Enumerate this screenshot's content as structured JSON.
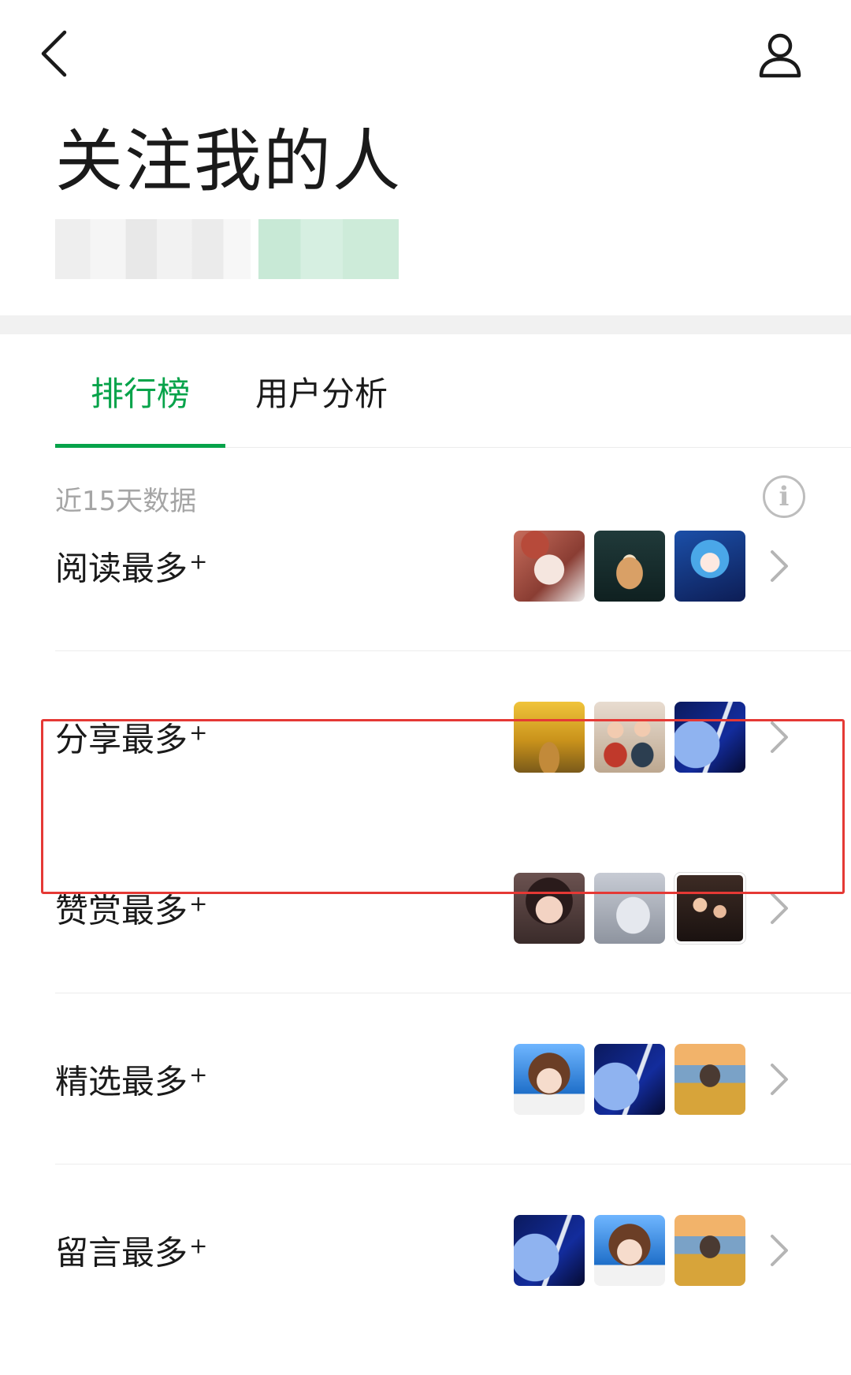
{
  "header": {
    "title": "关注我的人",
    "back_icon": "chevron-left-icon",
    "profile_icon": "user-icon"
  },
  "tabs": [
    {
      "label": "排行榜",
      "active": true
    },
    {
      "label": "用户分析",
      "active": false
    }
  ],
  "range_label": "近15天数据",
  "info_icon_text": "i",
  "rank_rows": [
    {
      "label": "阅读最多",
      "mark": "+",
      "avatars": [
        "doll",
        "cat",
        "anime-girl"
      ]
    },
    {
      "label": "分享最多",
      "mark": "+",
      "avatars": [
        "autumn-road",
        "family",
        "rocket-space"
      ],
      "highlighted": true
    },
    {
      "label": "赞赏最多",
      "mark": "+",
      "avatars": [
        "girl-face",
        "sleeping-person",
        "couple-photo"
      ]
    },
    {
      "label": "精选最多",
      "mark": "+",
      "avatars": [
        "cartoon-girl",
        "rocket-space",
        "mountain-landscape"
      ]
    },
    {
      "label": "留言最多",
      "mark": "+",
      "avatars": [
        "rocket-space",
        "cartoon-girl",
        "mountain-landscape"
      ]
    }
  ],
  "colors": {
    "accent": "#07a34a",
    "highlight_border": "#e53935",
    "muted_text": "#a5a5a5"
  }
}
